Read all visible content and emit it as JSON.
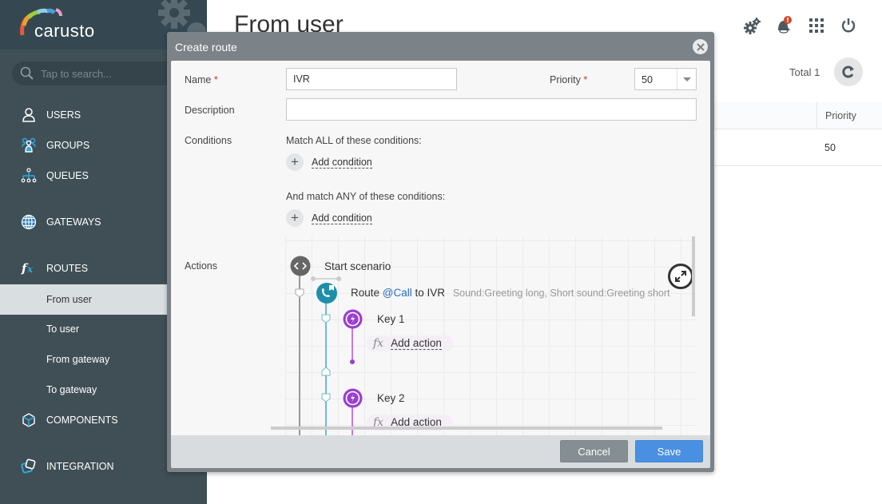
{
  "app": {
    "name": "carusto"
  },
  "sidebar": {
    "search_placeholder": "Tap to search...",
    "items": [
      {
        "label": "USERS",
        "icon": "user-icon"
      },
      {
        "label": "GROUPS",
        "icon": "groups-icon"
      },
      {
        "label": "QUEUES",
        "icon": "queues-icon"
      },
      {
        "label": "GATEWAYS",
        "icon": "globe-icon"
      },
      {
        "label": "ROUTES",
        "icon": "fx-icon"
      },
      {
        "label": "COMPONENTS",
        "icon": "cube-icon"
      },
      {
        "label": "INTEGRATION",
        "icon": "integration-icon"
      }
    ],
    "route_subitems": [
      {
        "label": "From user",
        "active": true
      },
      {
        "label": "To user",
        "active": false
      },
      {
        "label": "From gateway",
        "active": false
      },
      {
        "label": "To gateway",
        "active": false
      }
    ]
  },
  "main": {
    "title": "From user",
    "total_label": "Total 1",
    "table": {
      "columns": [
        "Priority"
      ],
      "rows": [
        [
          "50"
        ]
      ]
    },
    "top_icons": [
      "settings-icon",
      "notifications-icon",
      "apps-grid-icon",
      "power-icon"
    ]
  },
  "dialog": {
    "title": "Create route",
    "name_label": "Name",
    "name_value": "IVR",
    "priority_label": "Priority",
    "priority_value": "50",
    "description_label": "Description",
    "description_value": "",
    "conditions_label": "Conditions",
    "match_all_text": "Match ALL of these conditions:",
    "match_any_text": "And match ANY of these conditions:",
    "add_condition_label": "Add condition",
    "actions_label": "Actions",
    "scenario": {
      "start": "Start scenario",
      "route_prefix": "Route",
      "route_link": "@Call",
      "route_suffix": "to IVR",
      "route_details": "Sound:Greeting long, Short sound:Greeting short",
      "keys": [
        {
          "label": "Key 1",
          "add_action": "Add action"
        },
        {
          "label": "Key 2",
          "add_action": "Add action"
        }
      ]
    },
    "cancel_label": "Cancel",
    "save_label": "Save"
  },
  "colors": {
    "sidebar_bg": "#404f56",
    "accent_blue": "#4a90e2",
    "ivr_teal": "#1f8ea8",
    "key_purple": "#9b3fcf",
    "required_red": "#c0392b"
  }
}
